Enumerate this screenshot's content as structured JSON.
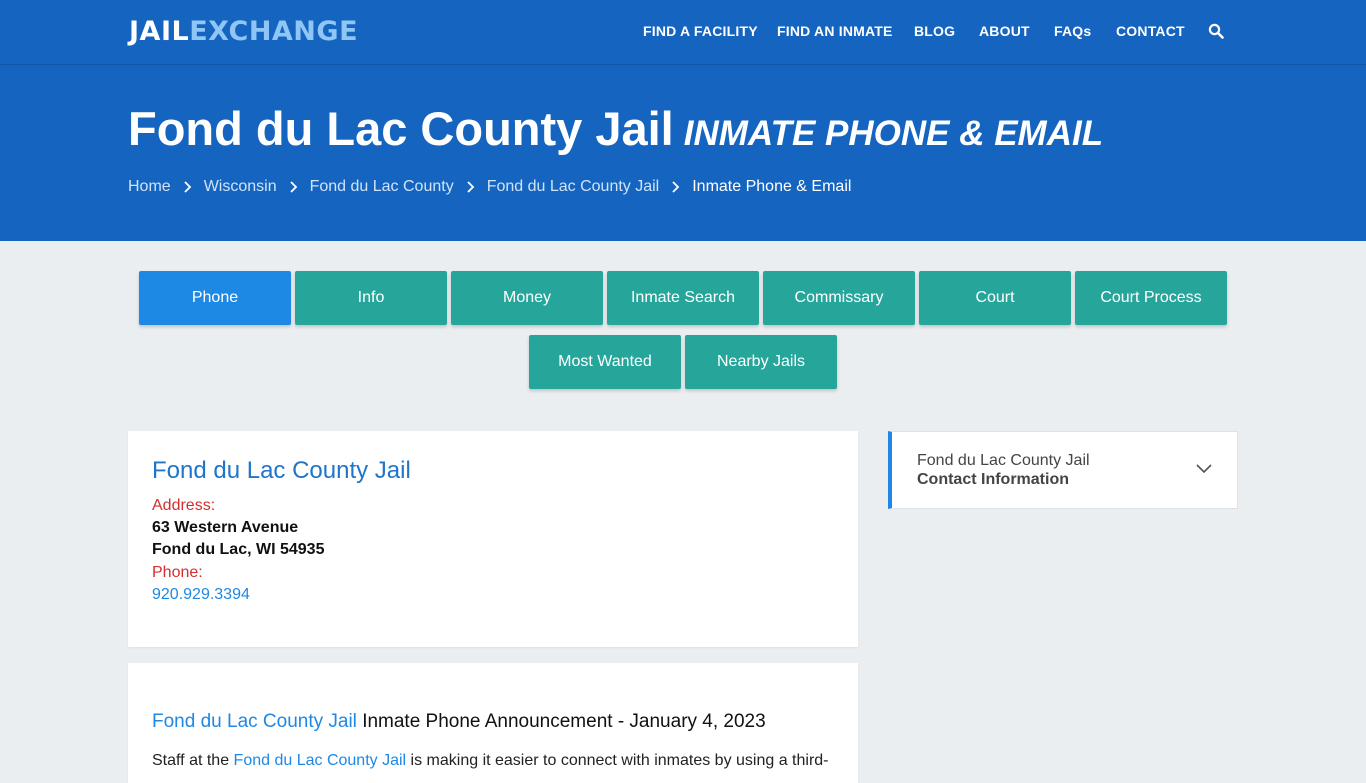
{
  "logo": {
    "part1": "JAIL",
    "part2": "EXCHANGE"
  },
  "nav": {
    "items": [
      "FIND A FACILITY",
      "FIND AN INMATE",
      "BLOG",
      "ABOUT",
      "FAQs",
      "CONTACT"
    ],
    "search_icon": "search-icon"
  },
  "hero": {
    "title": "Fond du Lac County Jail",
    "subtitle": "INMATE PHONE & EMAIL",
    "breadcrumbs": [
      "Home",
      "Wisconsin",
      "Fond du Lac County",
      "Fond du Lac County Jail",
      "Inmate Phone & Email"
    ]
  },
  "tabs": {
    "row1": [
      "Phone",
      "Info",
      "Money",
      "Inmate Search",
      "Commissary",
      "Court",
      "Court Process"
    ],
    "row2": [
      "Most Wanted",
      "Nearby Jails"
    ],
    "active": "Phone"
  },
  "facility": {
    "name": "Fond du Lac County Jail",
    "address_label": "Address:",
    "address_line1": "63 Western Avenue",
    "address_line2": "Fond du Lac, WI 54935",
    "phone_label": "Phone:",
    "phone": "920.929.3394"
  },
  "announcement": {
    "link_text": "Fond du Lac County Jail",
    "rest": "Inmate Phone Announcement - January 4, 2023",
    "para_start": "Staff at the ",
    "para_link": "Fond du Lac County Jail",
    "para_end": " is making it easier to connect with inmates by using a third-"
  },
  "sidebar": {
    "line1": "Fond du Lac County Jail",
    "line2": "Contact Information"
  },
  "colors": {
    "brand_blue": "#1565c0",
    "tab_teal": "#26a69a",
    "tab_active": "#1e88e5",
    "label_red": "#d32f2f",
    "link_blue": "#1e88e5"
  }
}
